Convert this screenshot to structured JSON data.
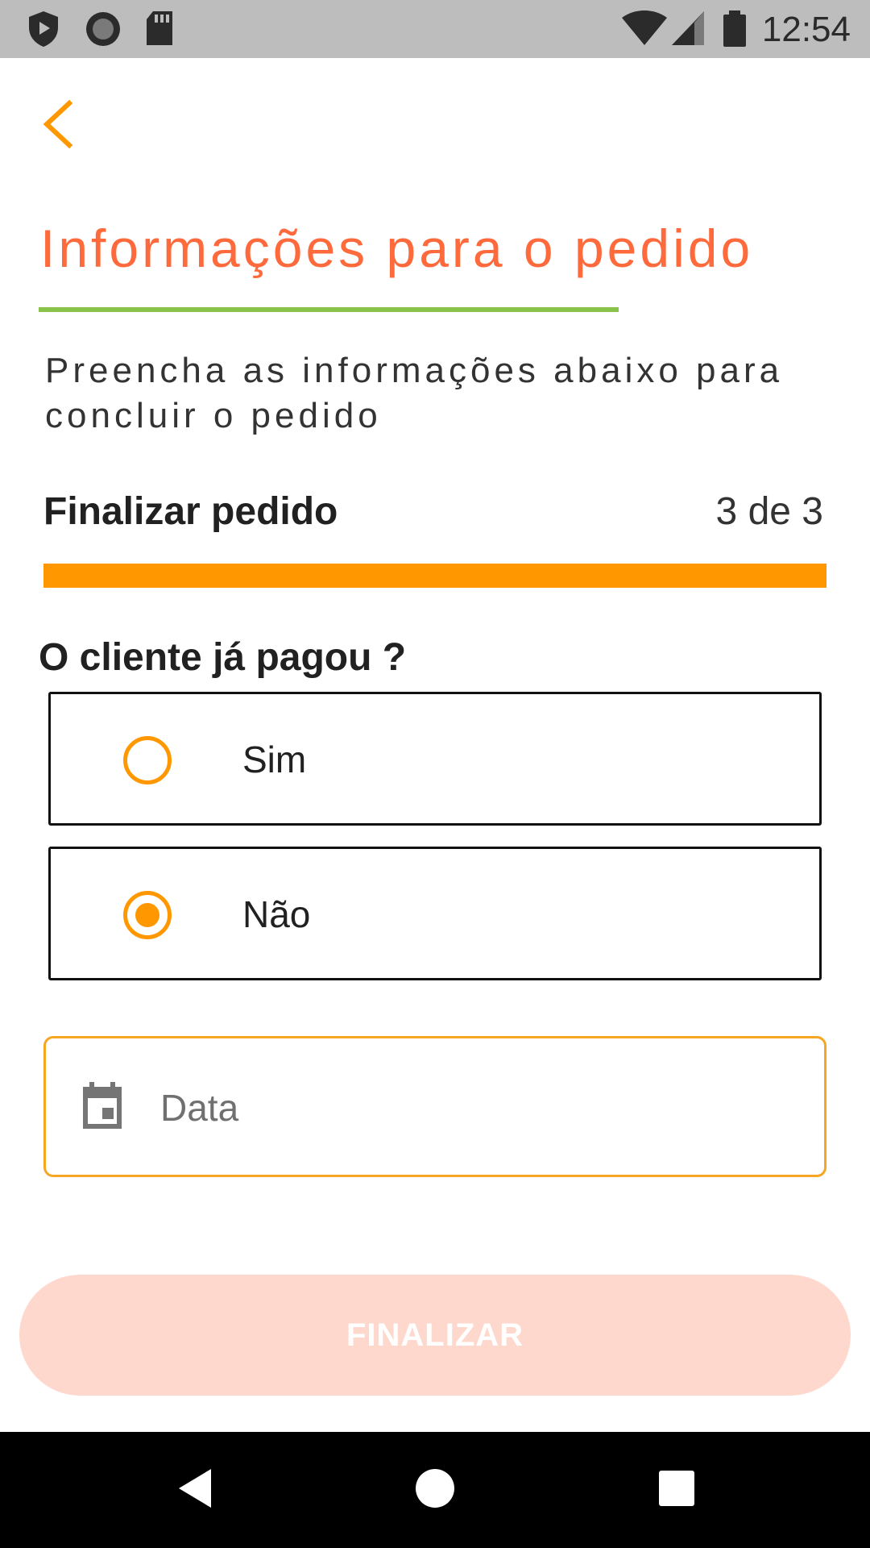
{
  "status_bar": {
    "time": "12:54",
    "left_icons": [
      "shield-play-icon",
      "record-icon",
      "sd-card-icon"
    ],
    "right_icons": [
      "wifi-icon",
      "cell-signal-icon",
      "battery-icon"
    ]
  },
  "header": {
    "back_icon": "chevron-left-icon",
    "title": "Informações para o pedido",
    "subtitle": "Preencha as informações abaixo para concluir o pedido"
  },
  "step": {
    "label": "Finalizar pedido",
    "count": "3 de 3",
    "progress": 1.0
  },
  "question": {
    "text": "O cliente já pagou ?",
    "options": [
      {
        "label": "Sim",
        "selected": false
      },
      {
        "label": "Não",
        "selected": true
      }
    ]
  },
  "date_field": {
    "icon": "calendar-icon",
    "placeholder": "Data",
    "value": ""
  },
  "actions": {
    "finish_label": "FINALIZAR"
  },
  "nav_bar": {
    "icons": [
      "back-triangle-icon",
      "home-circle-icon",
      "recents-square-icon"
    ]
  },
  "colors": {
    "accent_orange": "#ff9800",
    "title_orange": "#ff6a3d",
    "underline_green": "#8bc34a",
    "button_disabled": "#ffd8cd"
  }
}
